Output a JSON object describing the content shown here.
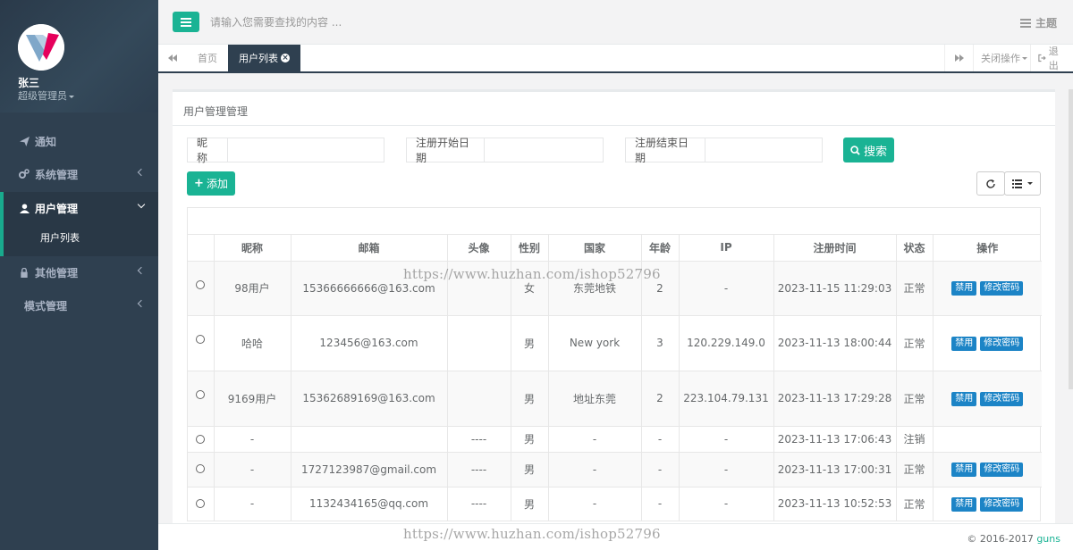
{
  "profile": {
    "name": "张三",
    "role": "超级管理员"
  },
  "sidebar": {
    "items": [
      {
        "label": "通知",
        "icon": "send-icon"
      },
      {
        "label": "系统管理",
        "icon": "cogs-icon"
      },
      {
        "label": "用户管理",
        "icon": "user-icon"
      },
      {
        "label": "其他管理",
        "icon": "lock-icon"
      },
      {
        "label": "模式管理",
        "icon": ""
      }
    ],
    "subitem": "用户列表"
  },
  "topbar": {
    "search_placeholder": "请输入您需要查找的内容 ...",
    "theme_label": "主题"
  },
  "tabs": {
    "items": [
      "首页",
      "用户列表"
    ],
    "close_ops": "关闭操作",
    "logout": "退出"
  },
  "panel": {
    "title": "用户管理管理"
  },
  "filters": {
    "nickname": "昵称",
    "start_date": "注册开始日期",
    "end_date": "注册结束日期",
    "search": "搜索",
    "add": "添加"
  },
  "table": {
    "columns": [
      "昵称",
      "邮箱",
      "头像",
      "性别",
      "国家",
      "年龄",
      "IP",
      "注册时间",
      "状态",
      "操作"
    ],
    "rows": [
      {
        "nickname": "98用户",
        "email": "15366666666@163.com",
        "avatar": "",
        "gender": "女",
        "country": "东莞地铁",
        "age": "2",
        "ip": "-",
        "reg_time": "2023-11-15 11:29:03",
        "status": "正常",
        "has_ops": true
      },
      {
        "nickname": "哈哈",
        "email": "123456@163.com",
        "avatar": "",
        "gender": "男",
        "country": "New york",
        "age": "3",
        "ip": "120.229.149.0",
        "reg_time": "2023-11-13 18:00:44",
        "status": "正常",
        "has_ops": true
      },
      {
        "nickname": "9169用户",
        "email": "15362689169@163.com",
        "avatar": "",
        "gender": "男",
        "country": "地址东莞",
        "age": "2",
        "ip": "223.104.79.131",
        "reg_time": "2023-11-13 17:29:28",
        "status": "正常",
        "has_ops": true
      },
      {
        "nickname": "-",
        "email": "",
        "avatar": "----",
        "gender": "男",
        "country": "-",
        "age": "-",
        "ip": "-",
        "reg_time": "2023-11-13 17:06:43",
        "status": "注销",
        "has_ops": false
      },
      {
        "nickname": "-",
        "email": "1727123987@gmail.com",
        "avatar": "----",
        "gender": "男",
        "country": "-",
        "age": "-",
        "ip": "-",
        "reg_time": "2023-11-13 17:00:31",
        "status": "正常",
        "has_ops": true
      },
      {
        "nickname": "-",
        "email": "1132434165@qq.com",
        "avatar": "----",
        "gender": "男",
        "country": "-",
        "age": "-",
        "ip": "-",
        "reg_time": "2023-11-13 10:52:53",
        "status": "正常",
        "has_ops": true
      }
    ],
    "op_disable": "禁用",
    "op_change_pwd": "修改密码"
  },
  "watermark": "https://www.huzhan.com/ishop52796",
  "footer": {
    "copyright": "© 2016-2017 ",
    "brand": "guns"
  },
  "colors": {
    "sidebar_bg": "#2f4050",
    "accent": "#1ab394",
    "op_button": "#1c84c6"
  }
}
